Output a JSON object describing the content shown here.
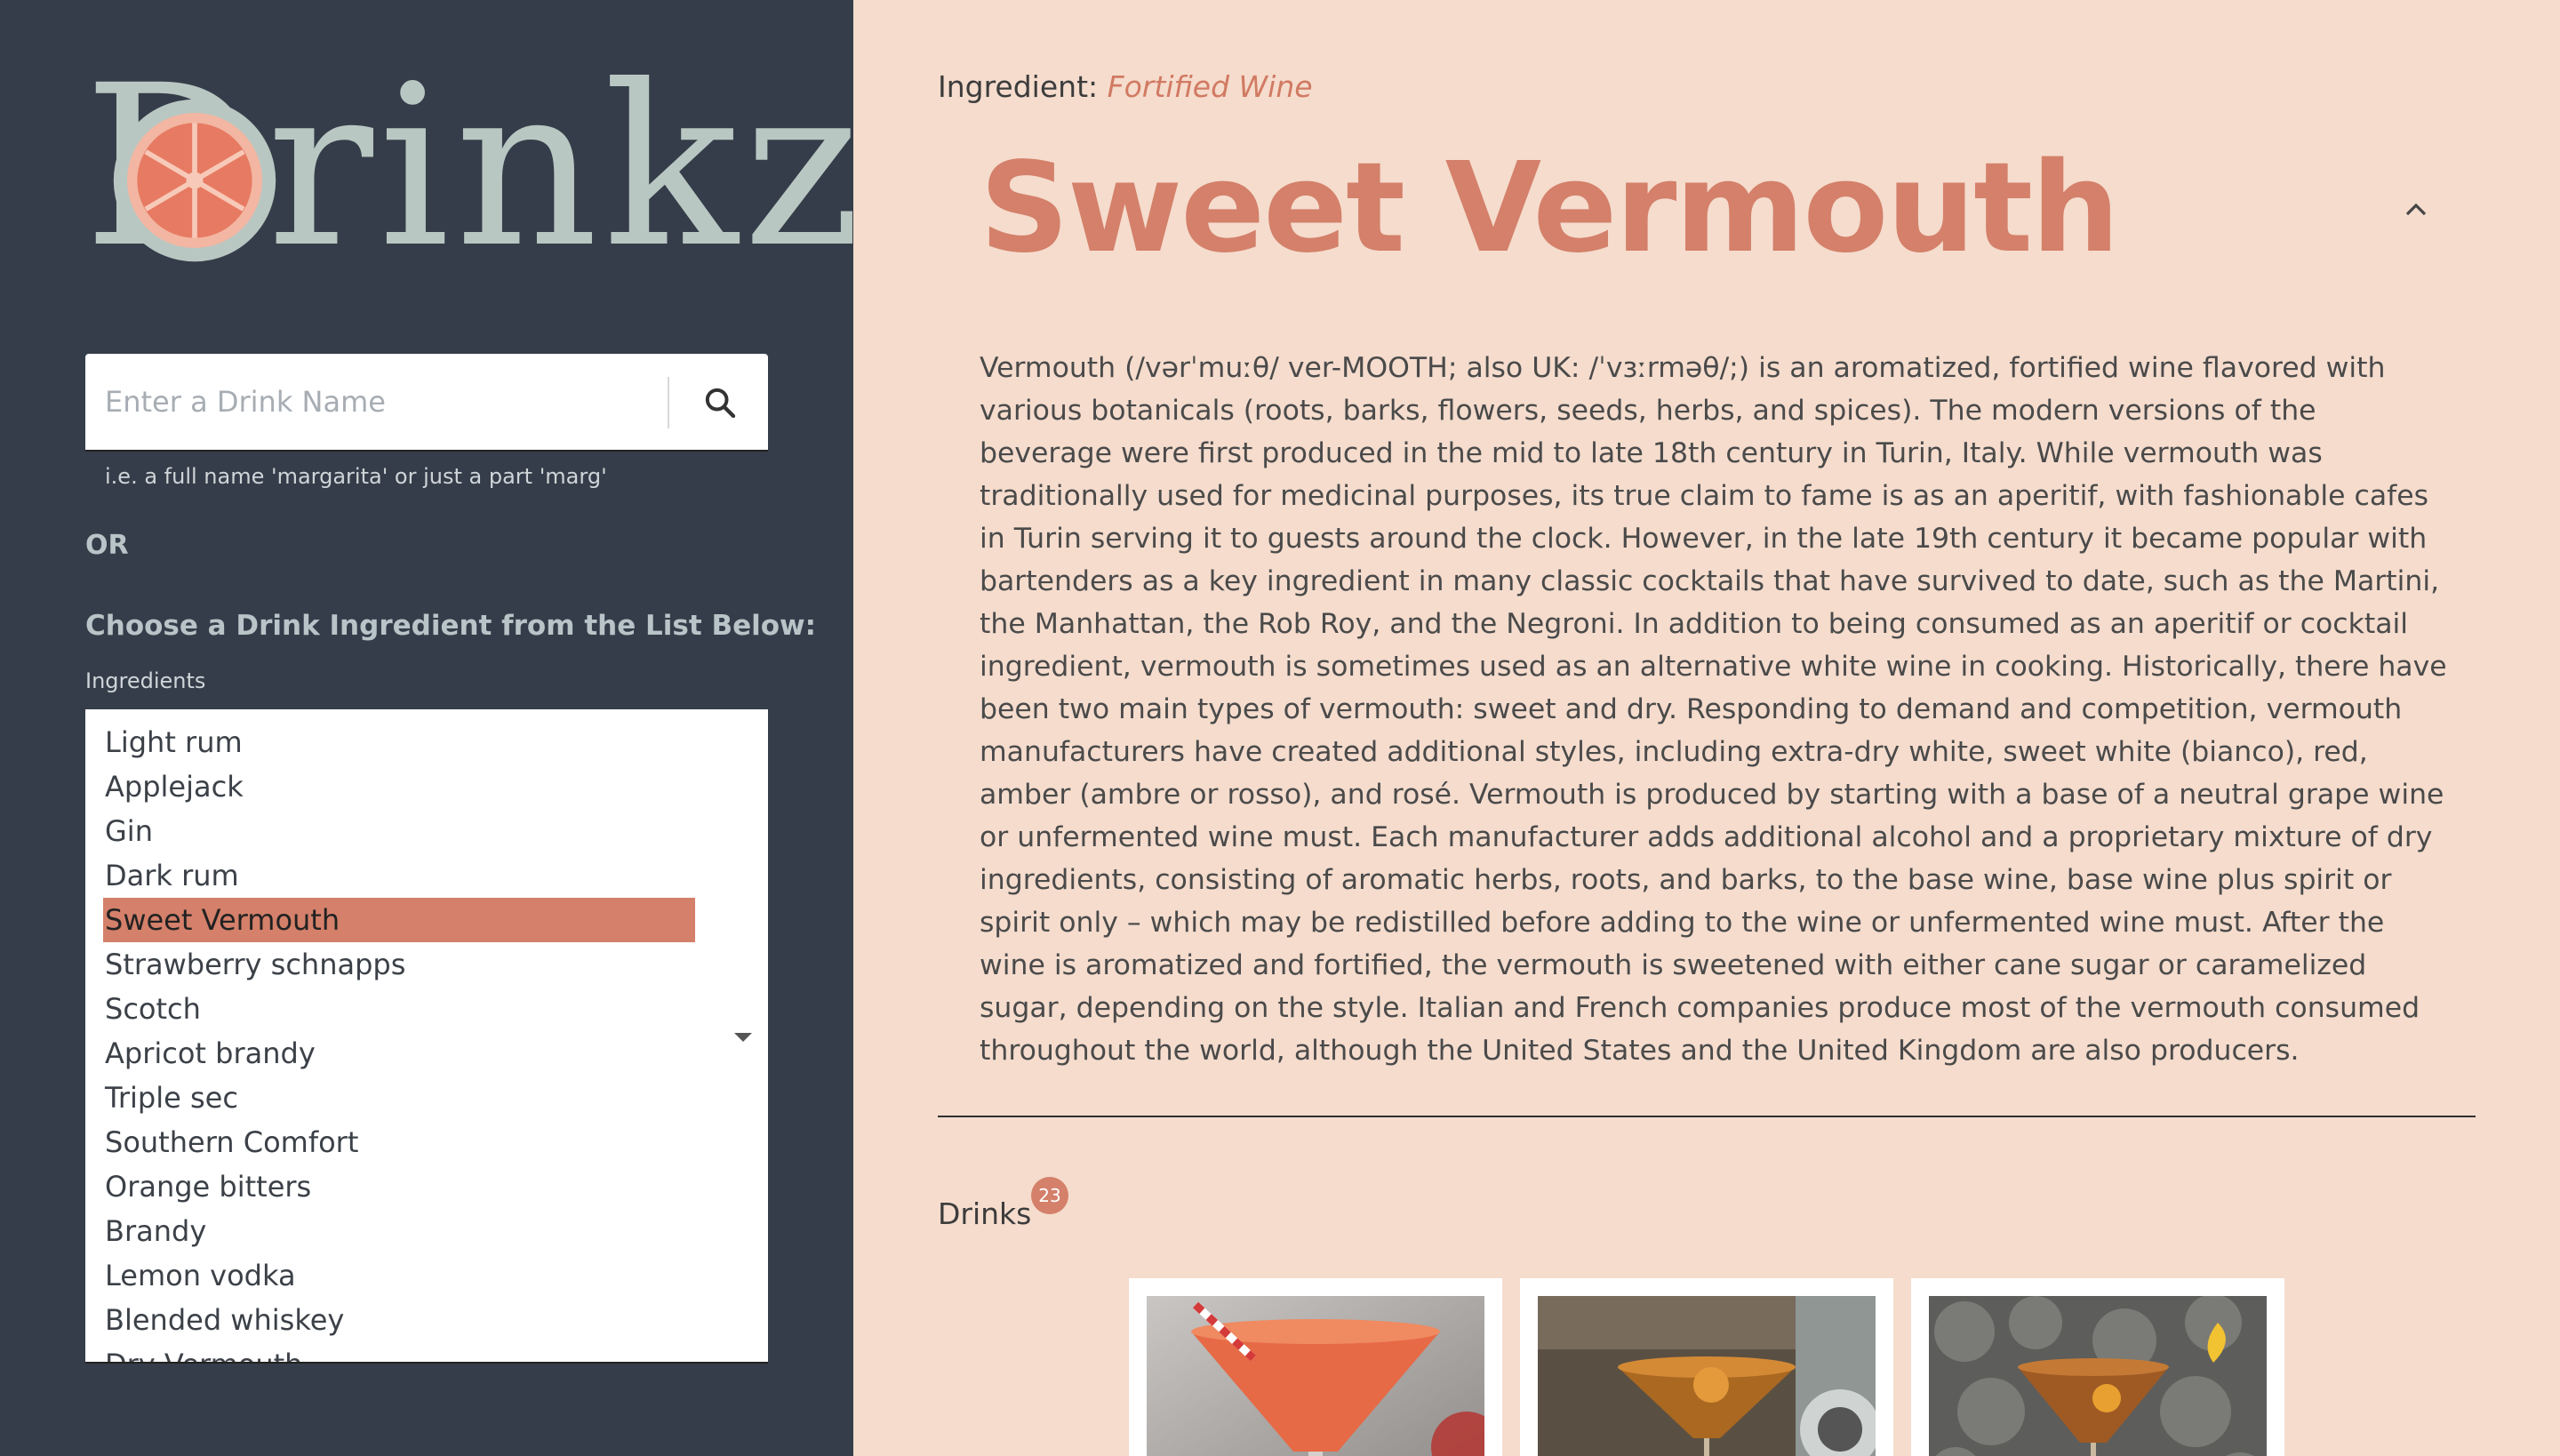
{
  "app": {
    "logo_text": "Drinkz"
  },
  "search": {
    "placeholder": "Enter a Drink Name",
    "hint": "i.e. a full name 'margarita' or just a part 'marg'",
    "icon": "search-icon"
  },
  "sidebar": {
    "or_label": "OR",
    "choose_label": "Choose a Drink Ingredient from the List Below:",
    "ingredients_label": "Ingredients",
    "ingredients": [
      "Light rum",
      "Applejack",
      "Gin",
      "Dark rum",
      "Sweet Vermouth",
      "Strawberry schnapps",
      "Scotch",
      "Apricot brandy",
      "Triple sec",
      "Southern Comfort",
      "Orange bitters",
      "Brandy",
      "Lemon vodka",
      "Blended whiskey",
      "Dry Vermouth"
    ],
    "selected_ingredient": "Sweet Vermouth"
  },
  "main": {
    "breadcrumb_label": "Ingredient:",
    "breadcrumb_value": "Fortified Wine",
    "title": "Sweet Vermouth",
    "description": "Vermouth (/vərˈmuːθ/ ver-MOOTH; also UK: /ˈvɜːrməθ/;) is an aromatized, fortified wine flavored with various botanicals (roots, barks, flowers, seeds, herbs, and spices).  The modern versions of the beverage were first produced in the mid to late 18th century in Turin, Italy. While vermouth was traditionally used for medicinal purposes, its true claim to fame is as an aperitif, with fashionable cafes in Turin serving it to guests around the clock. However, in the late 19th century it became popular with bartenders as a key ingredient in many classic cocktails that have survived to date, such as the Martini, the Manhattan, the Rob Roy, and the Negroni. In addition to being consumed as an aperitif or cocktail ingredient, vermouth is sometimes used as an alternative white wine in cooking.  Historically, there have been two main types of vermouth: sweet and dry. Responding to demand and competition, vermouth manufacturers have created additional styles, including extra-dry white, sweet white (bianco), red, amber (ambre or rosso), and rosé. Vermouth is produced by starting with a base of a neutral grape wine or unfermented wine must. Each manufacturer adds additional alcohol and a proprietary mixture of dry ingredients, consisting of aromatic herbs, roots, and barks, to the base wine, base wine plus spirit or spirit only – which may be redistilled before adding to the wine or unfermented wine must. After the wine is aromatized and fortified, the vermouth is sweetened with either cane sugar or caramelized sugar, depending on the style. Italian and French companies produce most of the vermouth consumed throughout the world, although the United States and the United Kingdom are also producers.",
    "drinks_label": "Drinks",
    "drinks_count": "23"
  },
  "colors": {
    "sidebar_bg": "#353d4a",
    "main_bg": "#f5dccd",
    "accent": "#d4806a",
    "logo": "#b9c7c2"
  }
}
